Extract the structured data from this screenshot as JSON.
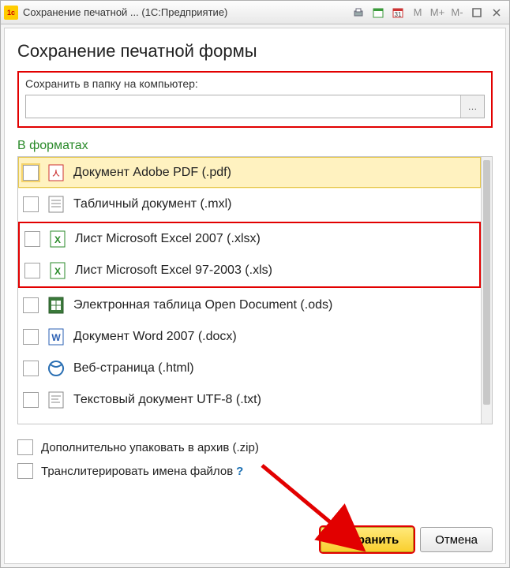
{
  "titlebar": {
    "title": "Сохранение печатной ...   (1С:Предприятие)",
    "m_label": "M",
    "mplus_label": "M+",
    "mminus_label": "M-"
  },
  "heading": "Сохранение печатной формы",
  "folder": {
    "label": "Сохранить в папку на компьютер:",
    "value": "",
    "placeholder": ""
  },
  "formats_title": "В форматах",
  "formats": [
    {
      "label": "Документ Adobe PDF (.pdf)",
      "icon": "pdf",
      "selected": true
    },
    {
      "label": "Табличный документ (.mxl)",
      "icon": "mxl",
      "selected": false
    },
    {
      "label": "Лист Microsoft Excel 2007 (.xlsx)",
      "icon": "excel",
      "selected": false
    },
    {
      "label": "Лист Microsoft Excel 97-2003 (.xls)",
      "icon": "excel",
      "selected": false
    },
    {
      "label": "Электронная таблица Open Document (.ods)",
      "icon": "ods",
      "selected": false
    },
    {
      "label": "Документ Word 2007 (.docx)",
      "icon": "word",
      "selected": false
    },
    {
      "label": "Веб-страница (.html)",
      "icon": "html",
      "selected": false
    },
    {
      "label": "Текстовый документ UTF-8 (.txt)",
      "icon": "txt",
      "selected": false
    }
  ],
  "options": {
    "zip_label": "Дополнительно упаковать в архив (.zip)",
    "translit_label": "Транслитерировать имена файлов",
    "help": "?"
  },
  "buttons": {
    "save": "Сохранить",
    "cancel": "Отмена"
  },
  "colors": {
    "highlight": "#e20000",
    "primary_btn": "#f9cf2e",
    "section_title": "#2a8a2a"
  }
}
